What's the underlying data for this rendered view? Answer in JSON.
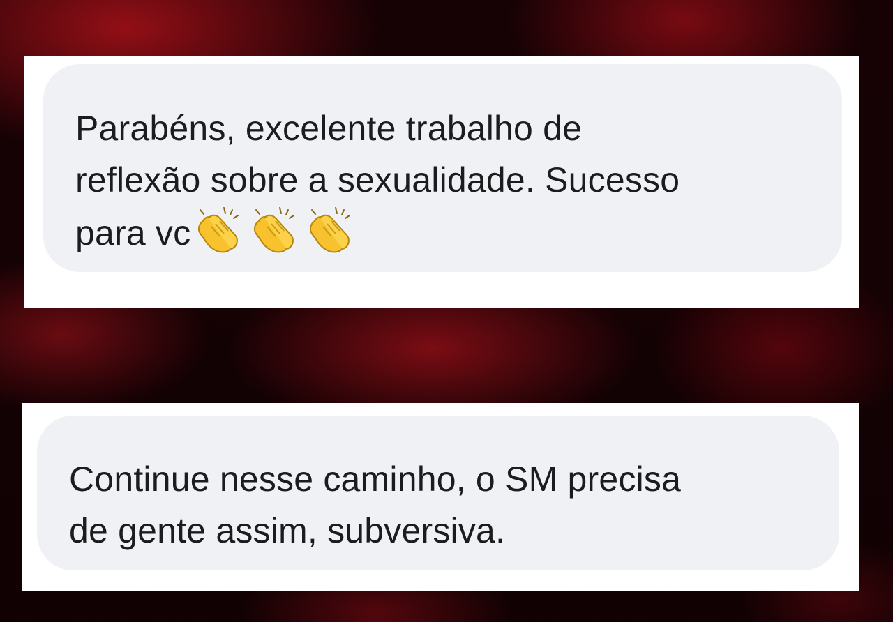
{
  "comments": [
    {
      "lines": [
        "Parabéns, excelente trabalho de",
        "reflexão sobre a sexualidade. Sucesso",
        "para vc"
      ],
      "emoji": [
        "clapping-hands",
        "clapping-hands",
        "clapping-hands"
      ]
    },
    {
      "lines": [
        "Continue nesse caminho, o SM precisa",
        "de gente assim, subversiva."
      ]
    }
  ],
  "colors": {
    "card": "#ffffff",
    "bubble": "#eff1f4",
    "text": "#1c1c1e",
    "emoji_skin": "#f7c22e",
    "background_accent": "#c8141e"
  }
}
